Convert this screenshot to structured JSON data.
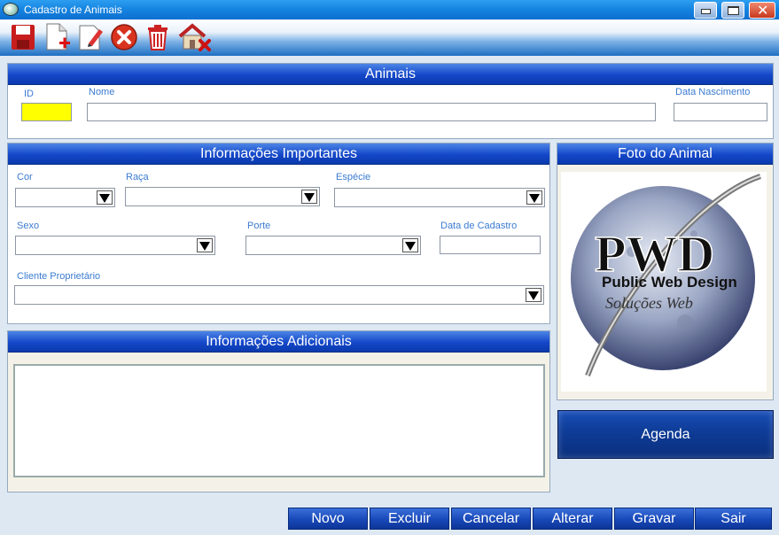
{
  "window": {
    "title": "Cadastro de Animais"
  },
  "toolbar": {
    "icons": [
      "save-icon",
      "new-document-icon",
      "edit-icon",
      "cancel-icon",
      "trash-icon",
      "home-delete-icon"
    ]
  },
  "animais": {
    "header": "Animais",
    "id_label": "ID",
    "nome_label": "Nome",
    "data_nascimento_label": "Data Nascimento",
    "id_value": "",
    "nome_value": "",
    "data_nascimento_value": ""
  },
  "info_importantes": {
    "header": "Informações Importantes",
    "cor_label": "Cor",
    "raca_label": "Raça",
    "especie_label": "Espécie",
    "sexo_label": "Sexo",
    "porte_label": "Porte",
    "data_cadastro_label": "Data de Cadastro",
    "cliente_label": "Cliente Proprietário"
  },
  "info_adicionais": {
    "header": "Informações Adicionais",
    "value": ""
  },
  "foto": {
    "header": "Foto do Animal",
    "logo_main": "PWD",
    "logo_sub": "Public Web Design",
    "logo_script": "Soluções Web"
  },
  "agenda_label": "Agenda",
  "buttons": {
    "novo": "Novo",
    "excluir": "Excluir",
    "cancelar": "Cancelar",
    "alterar": "Alterar",
    "gravar": "Gravar",
    "sair": "Sair"
  },
  "colors": {
    "id_field": "#ffff00",
    "header_blue": "#1447c9",
    "label_blue": "#3b7bd1"
  }
}
